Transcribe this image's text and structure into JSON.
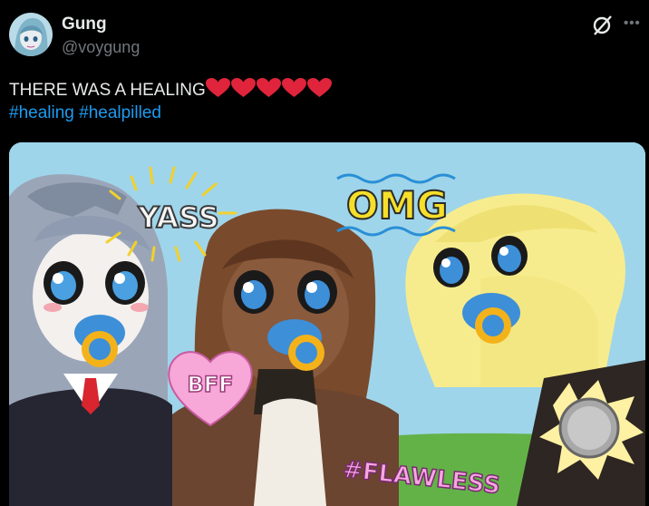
{
  "tweet": {
    "author": {
      "display_name": "Gung",
      "handle": "@voygung"
    },
    "text": "THERE WAS A HEALING",
    "hearts": [
      "❤️",
      "❤️",
      "❤️",
      "❤️",
      "❤️"
    ],
    "hashtags": [
      "#healing",
      "#healpilled"
    ],
    "actions": {
      "grok_icon": "grok-icon",
      "more_icon": "more-icon"
    }
  },
  "media": {
    "stickers": {
      "yass": "YASS",
      "omg": "OMG",
      "bff": "BFF",
      "flawless": "#FLAWLESS"
    }
  },
  "colors": {
    "background": "#000000",
    "text": "#e7e9ea",
    "muted": "#71767b",
    "link": "#1d9bf0",
    "heart": "#e0243b",
    "sky": "#9fd5ea"
  }
}
